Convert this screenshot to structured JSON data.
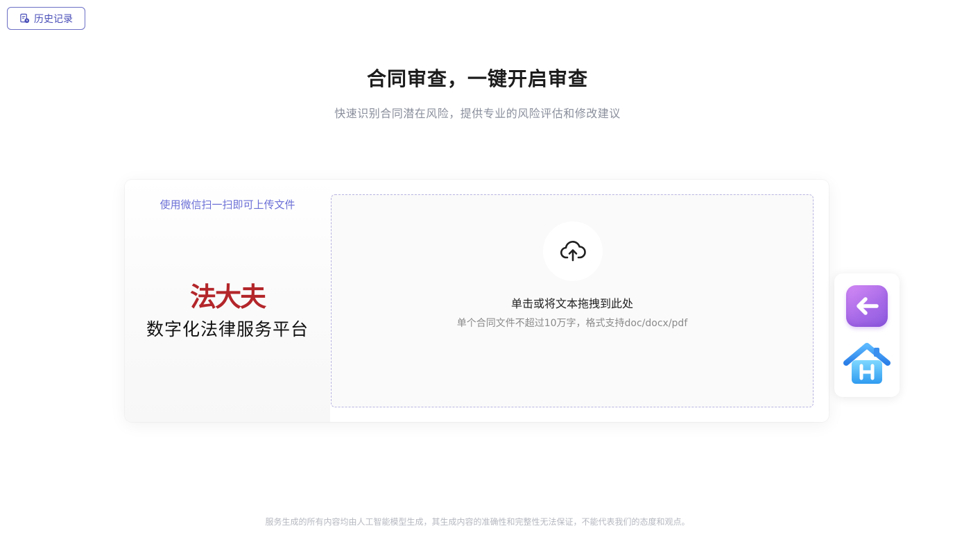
{
  "header": {
    "history_button": {
      "label": "历史记录",
      "icon": "history-doc-icon"
    }
  },
  "hero": {
    "title": "合同审查，一键开启审查",
    "subtitle": "快速识别合同潜在风险，提供专业的风险评估和修改建议"
  },
  "qr_panel": {
    "hint": "使用微信扫一扫即可上传文件",
    "logo_text": "法大夫",
    "platform_name": "数字化法律服务平台"
  },
  "upload": {
    "icon": "cloud-upload-icon",
    "title": "单击或将文本拖拽到此处",
    "subtitle": "单个合同文件不超过10万字，格式支持doc/docx/pdf"
  },
  "float_nav": {
    "back_icon": "arrow-left-icon",
    "home_icon": "home-icon"
  },
  "footer": {
    "disclaimer": "服务生成的所有内容均由人工智能模型生成，其生成内容的准确性和完整性无法保证，不能代表我们的态度和观点。"
  },
  "colors": {
    "accent": "#4a4fb8",
    "hint": "#6b6fd6",
    "logo": "#b3262a",
    "dashed_border": "#b7b3e0"
  }
}
